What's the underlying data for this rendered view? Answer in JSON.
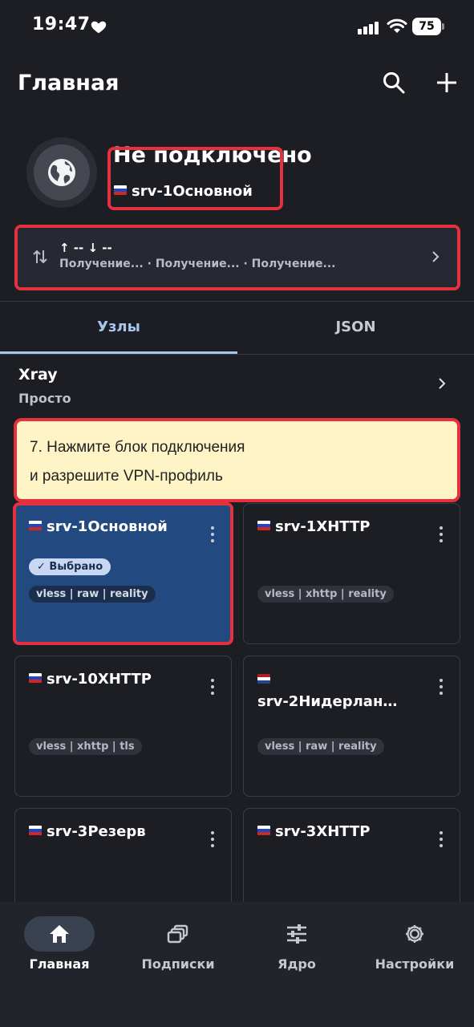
{
  "status_bar": {
    "time": "19:47",
    "battery": "75"
  },
  "header": {
    "title": "Главная"
  },
  "connection": {
    "status": "Не подключено",
    "server": "srv-1Основной",
    "traffic_up_down": "↑ --  ↓ --",
    "traffic_detail": "Получение... · Получение... · Получение..."
  },
  "tabs": [
    {
      "label": "Узлы",
      "active": true
    },
    {
      "label": "JSON",
      "active": false
    }
  ],
  "core": {
    "name": "Xray",
    "mode": "Просто"
  },
  "tip": {
    "line1": "7. Нажмите блок подключения",
    "line2": "и разрешите VPN-профиль"
  },
  "servers": [
    {
      "name": "srv-1Основной",
      "flag": "RU",
      "badge": "✓ Выбрано",
      "tag": "vless | raw | reality",
      "selected": true
    },
    {
      "name": "srv-1XHTTP",
      "flag": "RU",
      "tag": "vless | xhttp | reality",
      "selected": false
    },
    {
      "name": "srv-10XHTTP",
      "flag": "RU",
      "tag": "vless | xhttp | tls",
      "selected": false
    },
    {
      "name": "srv-2Нидерлан…",
      "flag": "NL",
      "tag": "vless | raw | reality",
      "selected": false
    },
    {
      "name": "srv-3Резерв",
      "flag": "RU",
      "tag": "",
      "selected": false
    },
    {
      "name": "srv-3XHTTP",
      "flag": "RU",
      "tag": "",
      "selected": false
    }
  ],
  "bottom_nav": [
    {
      "label": "Главная",
      "icon": "home-icon",
      "active": true
    },
    {
      "label": "Подписки",
      "icon": "subscriptions-icon",
      "active": false
    },
    {
      "label": "Ядро",
      "icon": "sliders-icon",
      "active": false
    },
    {
      "label": "Настройки",
      "icon": "gear-icon",
      "active": false
    }
  ],
  "colors": {
    "background": "#1c1e24",
    "accent": "#a9c7ee",
    "selected_card": "#234a80",
    "highlight": "#e5303e",
    "tip_background": "#fff4c5"
  }
}
